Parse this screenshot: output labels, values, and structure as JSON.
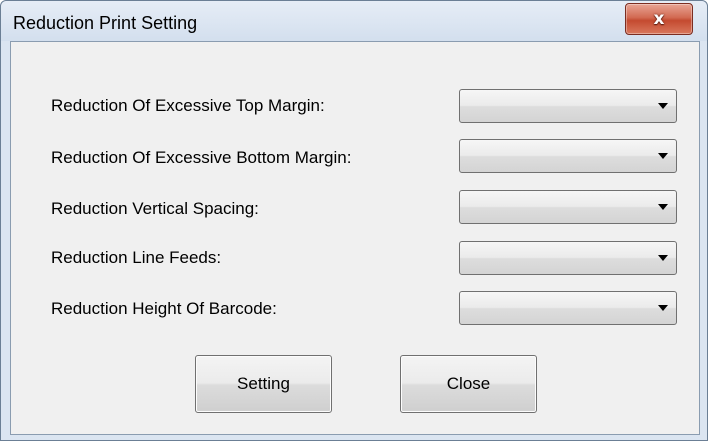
{
  "window": {
    "title": "Reduction Print Setting",
    "close_glyph": "x"
  },
  "rows": [
    {
      "label": "Reduction Of Excessive Top Margin:",
      "value": ""
    },
    {
      "label": "Reduction Of Excessive Bottom Margin:",
      "value": ""
    },
    {
      "label": "Reduction Vertical Spacing:",
      "value": ""
    },
    {
      "label": "Reduction Line Feeds:",
      "value": ""
    },
    {
      "label": "Reduction Height Of Barcode:",
      "value": ""
    }
  ],
  "buttons": {
    "setting": "Setting",
    "close": "Close"
  },
  "colors": {
    "window_frame": "#dbe5f1",
    "client_background": "#f0f0f0",
    "close_button": "#c44a30"
  },
  "icons": {
    "close": "close-icon",
    "dropdown": "chevron-down-icon"
  }
}
